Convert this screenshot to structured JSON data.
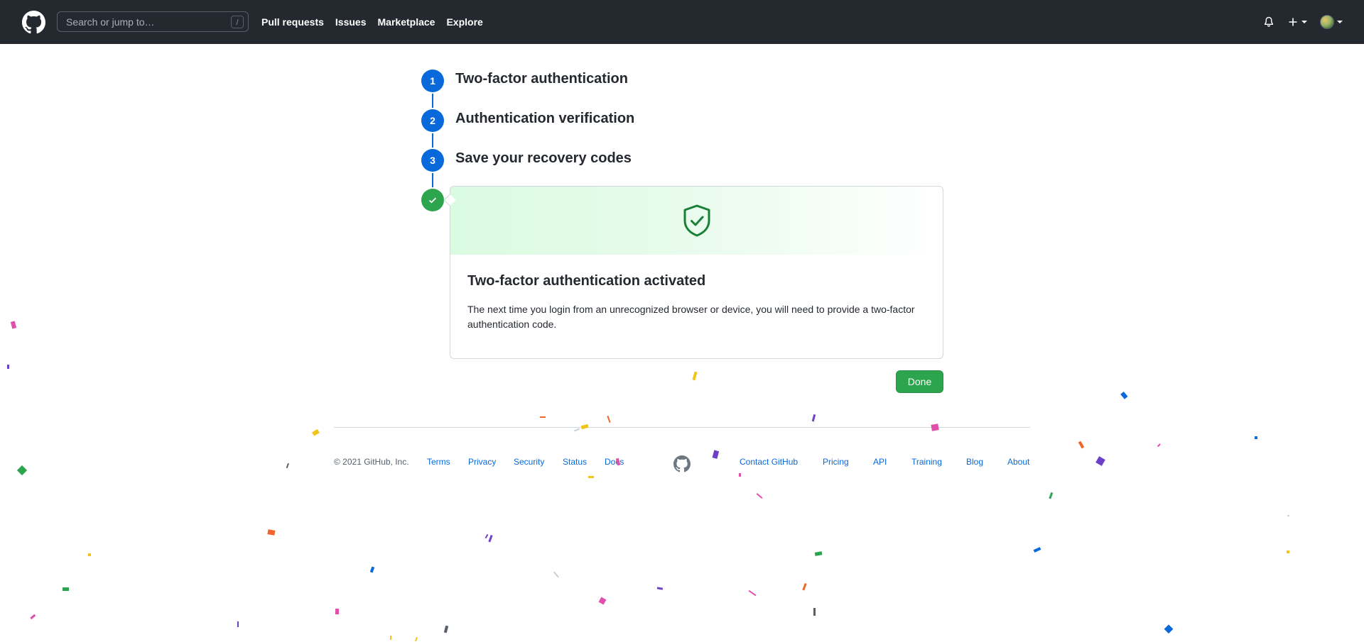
{
  "header": {
    "search": {
      "placeholder": "Search or jump to…",
      "shortcut": "/"
    },
    "nav": [
      "Pull requests",
      "Issues",
      "Marketplace",
      "Explore"
    ],
    "icons": [
      "github-logo-icon",
      "bell-icon",
      "plus-icon",
      "avatar"
    ]
  },
  "steps": [
    {
      "number": "1",
      "title": "Two-factor authentication"
    },
    {
      "number": "2",
      "title": "Authentication verification"
    },
    {
      "number": "3",
      "title": "Save your recovery codes"
    }
  ],
  "card": {
    "title": "Two-factor authentication activated",
    "text": "The next time you login from an unrecognized browser or device, you will need to provide a two-factor authentication code.",
    "icon": "shield-check-icon"
  },
  "done_button": "Done",
  "footer": {
    "copyright": "© 2021 GitHub, Inc.",
    "left_links": [
      "Terms",
      "Privacy",
      "Security",
      "Status",
      "Docs"
    ],
    "right_links": [
      "Contact GitHub",
      "Pricing",
      "API",
      "Training",
      "Blog",
      "About"
    ]
  },
  "colors": {
    "header_bg": "#24292f",
    "accent_blue": "#0969da",
    "success_green": "#2da44e",
    "confetti": [
      "#e14fad",
      "#6e40c9",
      "#2da44e",
      "#f0c419",
      "#f06529",
      "#0969da",
      "#57606a"
    ]
  }
}
